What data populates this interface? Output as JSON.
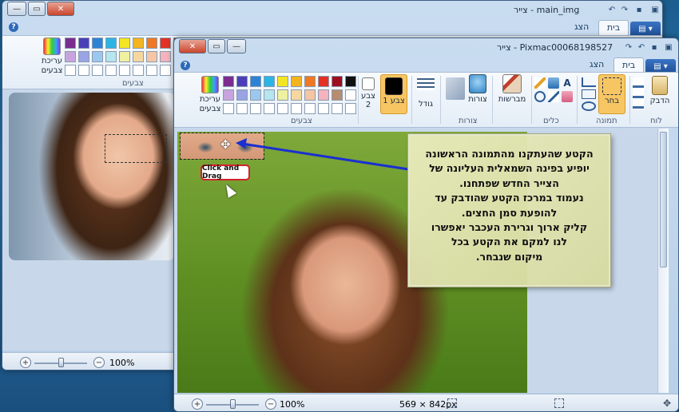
{
  "back_window": {
    "title": "צייר - main_img",
    "tabs": {
      "file": "▤ ▾",
      "home": "בית",
      "view": "הצג"
    },
    "edit_colors_label": "עריכת צבעים",
    "colors_group_label": "צבעים",
    "zoom_level": "100%"
  },
  "front_window": {
    "title": "צייר - Pixmac00068198527",
    "tabs": {
      "file": "▤ ▾",
      "home": "בית",
      "view": "הצג"
    },
    "clipboard": {
      "paste_label": "הדבק",
      "group_label": "לוח"
    },
    "image": {
      "select_label": "בחר",
      "group_label": "תמונה"
    },
    "tools": {
      "group_label": "כלים"
    },
    "brushes_label": "מברשות",
    "shapes": {
      "shapes_label": "צורות",
      "group_label": "צורות"
    },
    "size_label": "גודל",
    "color1_label": "צבע 1",
    "color2_label": "צבע 2",
    "edit_colors_label": "עריכת צבעים",
    "colors_group_label": "צבעים",
    "zoom_level": "100%",
    "image_size": "569 × 842px"
  },
  "palette_row1": [
    "#7b2c8f",
    "#4b3fb8",
    "#2e82d6",
    "#2bb5e4",
    "#f2e524",
    "#f3b41f",
    "#f07823",
    "#e43124",
    "#9c0f1f",
    "#111111"
  ],
  "palette_row2": [
    "#c8a4de",
    "#9aa4e4",
    "#9dc8ee",
    "#b6e6ef",
    "#eff0a0",
    "#f6d7a0",
    "#f6c5a4",
    "#f4b3bd",
    "#b78c6f",
    "#ffffff"
  ],
  "palette_row2_back": [
    "#c8a4de",
    "#9aa4e4",
    "#9dc8ee",
    "#b6e6ef",
    "#eff0a0",
    "#f6d7a0",
    "#f6c5a4",
    "#f4b3bd",
    "#b78c6f",
    "#7f7f7f"
  ],
  "tooltip_text": "Click and Drag",
  "callout_lines": [
    "הקטע שהעתקנו מהתמונה הראשונה",
    "יופיע בפינה השמאלית העליונה של",
    "הצייר החדש שפתחנו.",
    "נעמוד במרכז הקטע שהודבק עד",
    "להופעת סמן החצים.",
    "קליק ארוך וגרירת העכבר יאפשרו",
    "לנו למקם את הקטע בכל",
    "מיקום שנבחר."
  ],
  "colors": {
    "arrow": "#1a2fd0",
    "tooltip_border": "#d2232a",
    "selected_tool": "#f7c663"
  }
}
